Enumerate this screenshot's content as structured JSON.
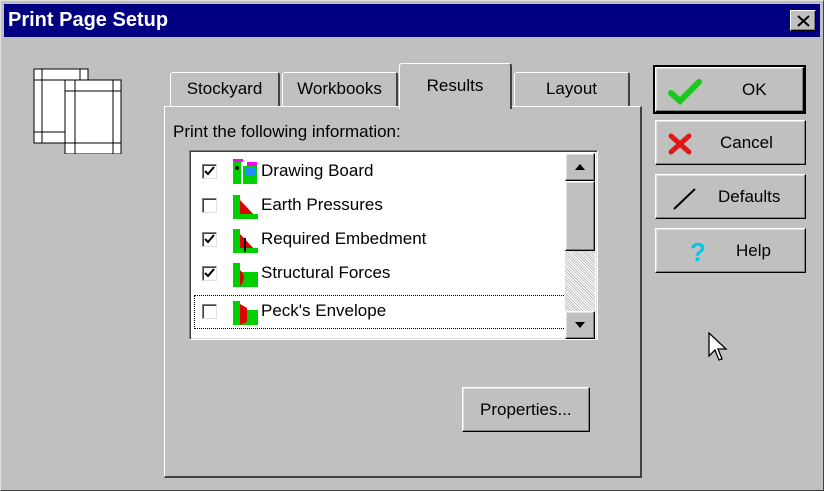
{
  "window": {
    "title": "Print Page Setup"
  },
  "tabs": [
    {
      "label": "Stockyard",
      "active": false
    },
    {
      "label": "Workbooks",
      "active": false
    },
    {
      "label": "Results",
      "active": true
    },
    {
      "label": "Layout",
      "active": false
    }
  ],
  "panel": {
    "caption": "Print the following information:"
  },
  "list": {
    "items": [
      {
        "label": "Drawing Board",
        "checked": true,
        "icon": "drawing-board-icon"
      },
      {
        "label": "Earth Pressures",
        "checked": false,
        "icon": "earth-pressures-icon"
      },
      {
        "label": "Required Embedment",
        "checked": true,
        "icon": "required-embedment-icon"
      },
      {
        "label": "Structural Forces",
        "checked": true,
        "icon": "structural-forces-icon"
      },
      {
        "label": "Peck's Envelope",
        "checked": false,
        "icon": "pecks-envelope-icon",
        "focused": true
      }
    ]
  },
  "buttons": {
    "properties": "Properties...",
    "ok": "OK",
    "cancel": "Cancel",
    "defaults": "Defaults",
    "help": "Help"
  },
  "colors": {
    "titlebar": "#000080",
    "face": "#c0c0c0",
    "ok_check": "#19c819",
    "cancel_x": "#e01818",
    "help_q": "#00c8e8",
    "icon_red": "#e00000",
    "icon_green": "#00d000"
  }
}
